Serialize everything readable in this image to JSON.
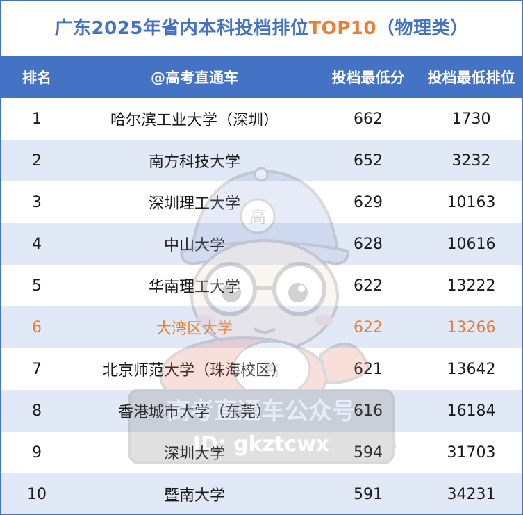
{
  "title": {
    "main": "广东2025年省内本科投档排位",
    "accent": "TOP10",
    "suffix": "（物理类）"
  },
  "columns": {
    "rank": "排名",
    "school": "@高考直通车",
    "score": "投档最低分",
    "position": "投档最低排位"
  },
  "rows": [
    {
      "rank": "1",
      "school": "哈尔滨工业大学（深圳）",
      "score": "662",
      "position": "1730"
    },
    {
      "rank": "2",
      "school": "南方科技大学",
      "score": "652",
      "position": "3232"
    },
    {
      "rank": "3",
      "school": "深圳理工大学",
      "score": "629",
      "position": "10163"
    },
    {
      "rank": "4",
      "school": "中山大学",
      "score": "628",
      "position": "10616"
    },
    {
      "rank": "5",
      "school": "华南理工大学",
      "score": "622",
      "position": "13222"
    },
    {
      "rank": "6",
      "school": "大湾区大学",
      "score": "622",
      "position": "13266"
    },
    {
      "rank": "7",
      "school": "北京师范大学（珠海校区）",
      "score": "621",
      "position": "13642"
    },
    {
      "rank": "8",
      "school": "香港城市大学（东莞）",
      "score": "616",
      "position": "16184"
    },
    {
      "rank": "9",
      "school": "深圳大学",
      "score": "594",
      "position": "31703"
    },
    {
      "rank": "10",
      "school": "暨南大学",
      "score": "591",
      "position": "34231"
    }
  ],
  "highlight_rank": "6",
  "watermark": {
    "cap_char": "高",
    "shirt_char": "高",
    "line1": "高考直通车公众号",
    "line2": "ID: gkztcwx"
  },
  "colors": {
    "header_bg": "#4472c4",
    "title_blue": "#4472c4",
    "accent_orange": "#ed7d31",
    "stripe": "#d9e2f3"
  }
}
